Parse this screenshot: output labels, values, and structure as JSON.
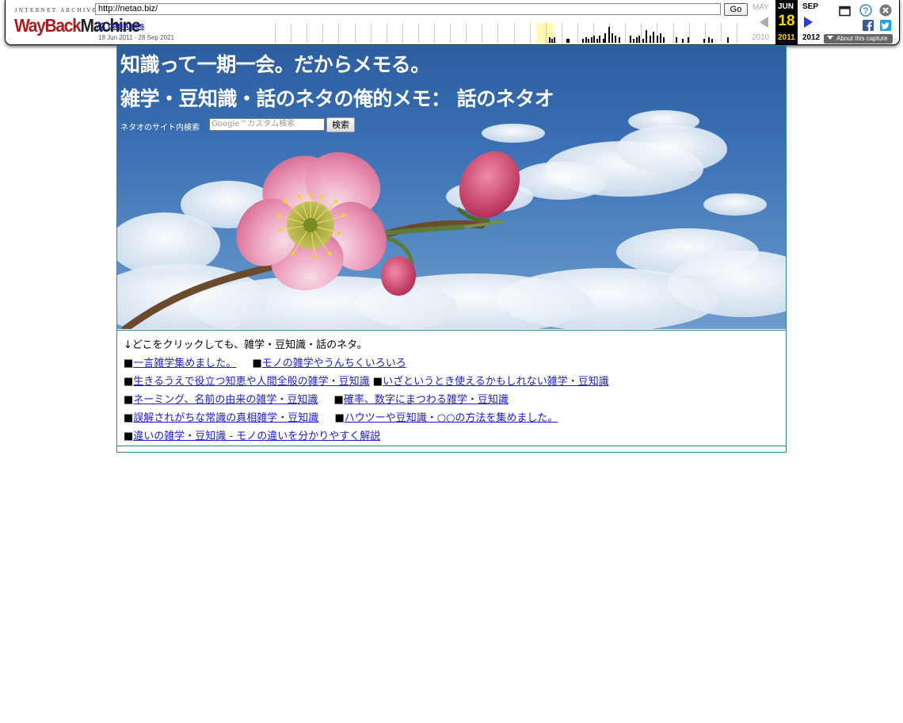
{
  "wayback": {
    "logo_top": "INTERNET ARCHIVE",
    "logo_wayback": "WayBack",
    "logo_machine": "Machine",
    "url": "http://netao.biz/",
    "go_label": "Go",
    "captures": "72 captures",
    "range": "18 Jun 2011 - 28 Sep 2021",
    "prev_month": "MAY",
    "cur_month": "JUN",
    "cur_day": "18",
    "cur_year": "2011",
    "next_month": "SEP",
    "prev_year": "2010",
    "next_year": "2012",
    "about": "About this capture",
    "colors": {
      "brand_red": "#ab1d1f",
      "link_blue": "#1a1ab8",
      "highlight": "#fff9b4",
      "day_gold": "#ffd700"
    }
  },
  "header": {
    "catch": "知識って一期一会。だからメモる。",
    "title": "雑学・豆知識・話のネタの俺的メモ： 話のネタオ",
    "search_label": "ネタオのサイト内検索",
    "search_placeholder": "Google™カスタム検索",
    "search_button": "検索"
  },
  "links": {
    "intro": "↓どこをクリックしても、雑学・豆知識・話のネタ。",
    "bullet": "■",
    "rows": [
      [
        "一言雑学集めました。",
        "モノの雑学やうんちくいろいろ"
      ],
      [
        "生きるうえで役立つ知恵や人間全般の雑学・豆知識",
        "いざというとき使えるかもしれない雑学・豆知識"
      ],
      [
        "ネーミング、名前の由来の雑学・豆知識",
        "確率、数字にまつわる雑学・豆知識"
      ],
      [
        "誤解されがちな常識の真相雑学・豆知識",
        "ハウツーや豆知識・○○の方法を集めました。"
      ],
      [
        "違いの雑学・豆知識 - モノの違いを分かりやすく解説"
      ]
    ]
  }
}
